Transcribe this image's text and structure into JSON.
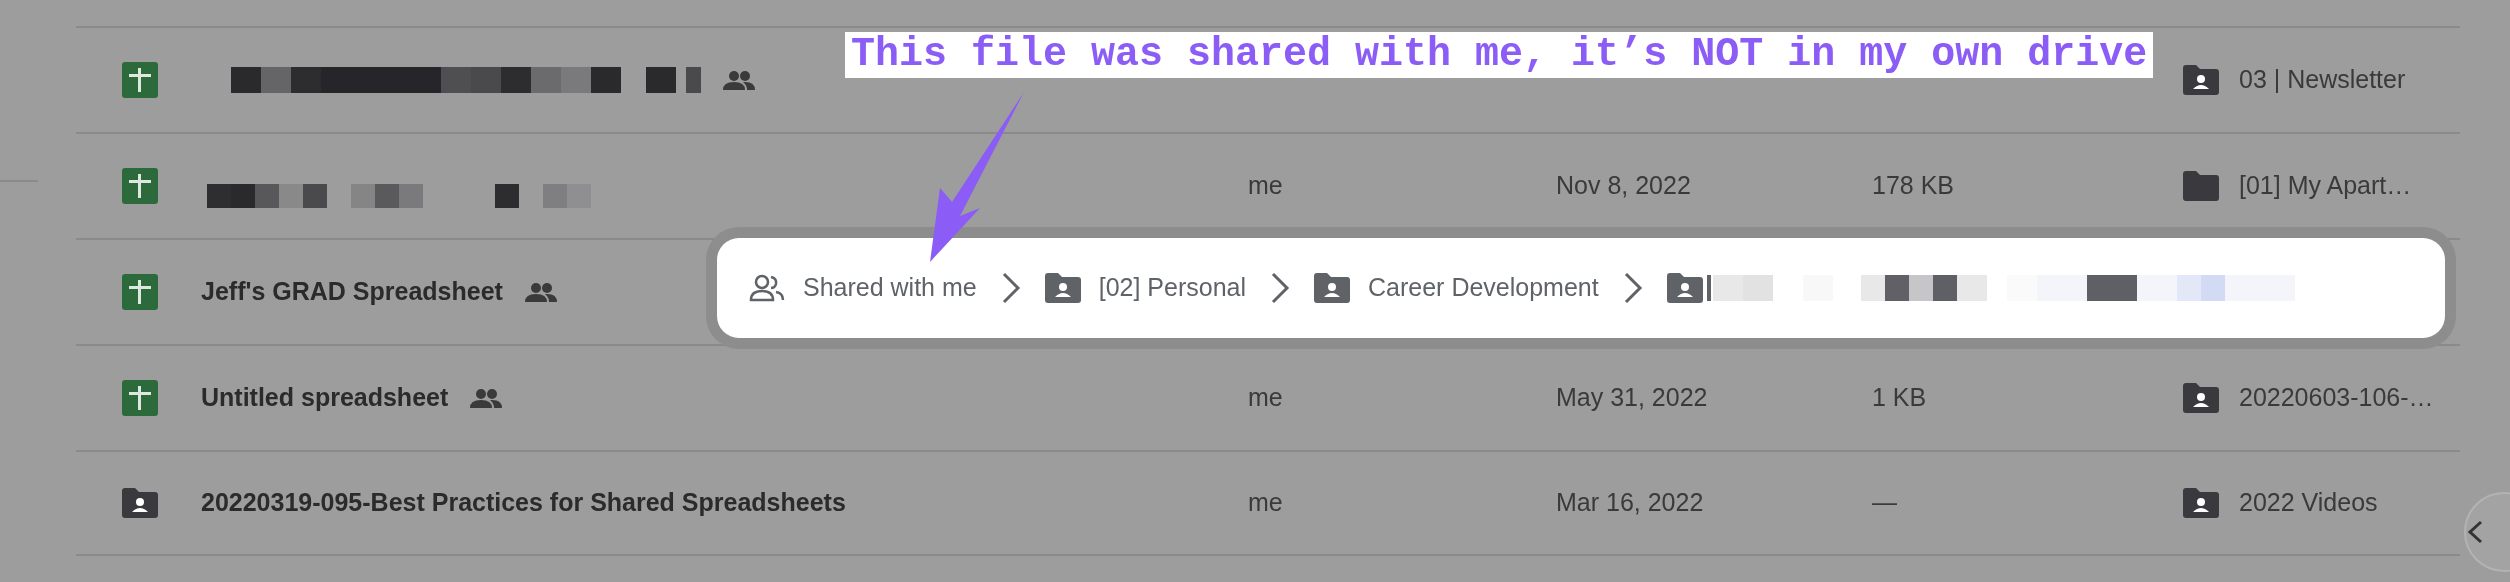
{
  "files": [
    {
      "kind": "spreadsheet",
      "shared": true,
      "location": {
        "kind": "shared-folder",
        "name": "03 | Newsletter"
      }
    },
    {
      "kind": "spreadsheet",
      "shared": false,
      "owner": "me",
      "modified": "Nov 8, 2022",
      "size": "178 KB",
      "location": {
        "kind": "folder",
        "name": "[01] My Apart…"
      }
    },
    {
      "kind": "spreadsheet",
      "name": "Jeff's GRAD Spreadsheet",
      "shared": true
    },
    {
      "kind": "spreadsheet",
      "name": "Untitled spreadsheet",
      "shared": true,
      "owner": "me",
      "modified": "May 31, 2022",
      "size": "1 KB",
      "location": {
        "kind": "shared-folder",
        "name": "20220603-106-…"
      }
    },
    {
      "kind": "shared-folder",
      "name": "20220319-095-Best Practices for Shared Spreadsheets",
      "shared": false,
      "owner": "me",
      "modified": "Mar 16, 2022",
      "size": "—",
      "location": {
        "kind": "shared-folder",
        "name": "2022 Videos"
      }
    }
  ],
  "breadcrumb": [
    {
      "kind": "shared-root",
      "label": "Shared with me"
    },
    {
      "kind": "shared-folder",
      "label": "[02] Personal"
    },
    {
      "kind": "shared-folder",
      "label": "Career Development"
    },
    {
      "kind": "shared-folder"
    }
  ],
  "annotation": {
    "text": "This file was shared with me, it’s NOT in my own drive"
  }
}
